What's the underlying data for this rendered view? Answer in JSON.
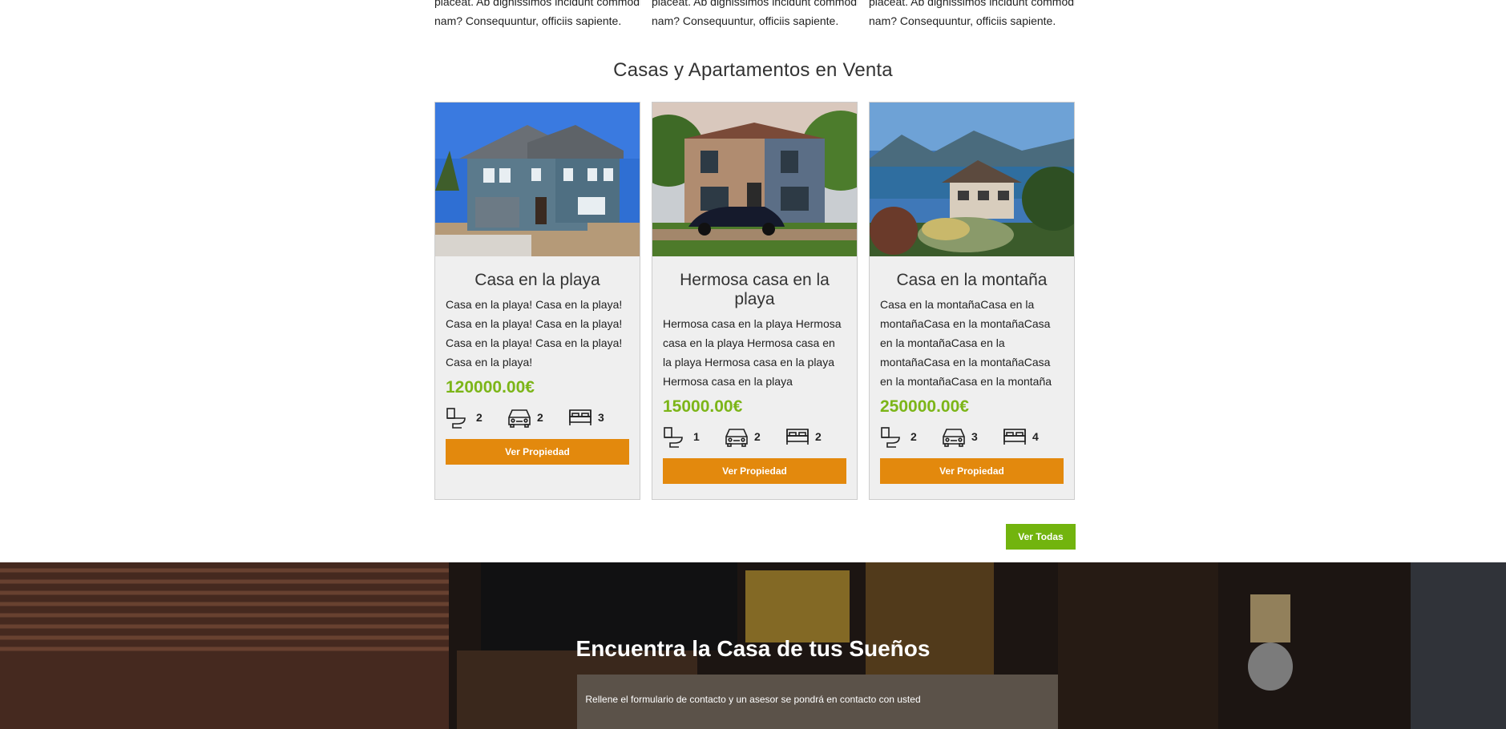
{
  "intro_columns": [
    {
      "line1": "placeat. Ab dignissimos incidunt commodi id",
      "line2": "nam? Consequuntur, officiis sapiente."
    },
    {
      "line1": "placeat. Ab dignissimos incidunt commodi id",
      "line2": "nam? Consequuntur, officiis sapiente."
    },
    {
      "line1": "placeat. Ab dignissimos incidunt commodi id",
      "line2": "nam? Consequuntur, officiis sapiente."
    }
  ],
  "section_title": "Casas y Apartamentos en Venta",
  "properties": [
    {
      "title": "Casa en la playa",
      "description": "Casa en la playa! Casa en la playa! Casa en la playa! Casa en la playa! Casa en la playa! Casa en la playa! Casa en la playa!",
      "price": "120000.00€",
      "bathrooms": "2",
      "parking": "2",
      "bedrooms": "3",
      "button": "Ver Propiedad"
    },
    {
      "title": "Hermosa casa en la playa",
      "description": "Hermosa casa en la playa Hermosa casa en la playa Hermosa casa en la playa Hermosa casa en la playa Hermosa casa en la playa",
      "price": "15000.00€",
      "bathrooms": "1",
      "parking": "2",
      "bedrooms": "2",
      "button": "Ver Propiedad"
    },
    {
      "title": "Casa en la montaña",
      "description": "Casa en la montañaCasa en la montañaCasa en la montañaCasa en la montañaCasa en la montañaCasa en la montañaCasa en la montañaCasa en la montaña",
      "price": "250000.00€",
      "bathrooms": "2",
      "parking": "3",
      "bedrooms": "4",
      "button": "Ver Propiedad"
    }
  ],
  "view_all": "Ver Todas",
  "hero": {
    "title": "Encuentra la Casa de tus Sueños",
    "subtitle": "Rellene el formulario de contacto y un asesor se pondrá en contacto con usted"
  },
  "colors": {
    "price_green": "#7cb518",
    "button_orange": "#e3890d",
    "button_green": "#72b40e",
    "card_bg": "#efefef"
  },
  "icons": [
    "toilet-icon",
    "car-icon",
    "bed-icon"
  ]
}
